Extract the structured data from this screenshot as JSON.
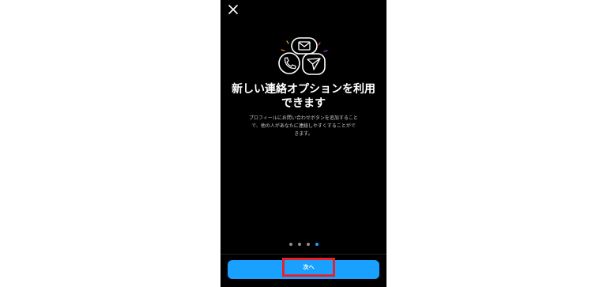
{
  "dialog": {
    "title": "新しい連絡オプションを利用\nできます",
    "body": "プロフィールにお問い合わせボタンを追加すること\nで、他の人があなたに連絡しやすくすることがで\nきます。",
    "next_label": "次へ",
    "close_icon": "close-icon",
    "hero_icons": [
      "mail-icon",
      "phone-icon",
      "send-icon"
    ]
  },
  "pagination": {
    "total": 4,
    "current": 4
  },
  "colors": {
    "accent": "#1aa1ff",
    "highlight_box": "#e8202a",
    "background": "#000000"
  }
}
